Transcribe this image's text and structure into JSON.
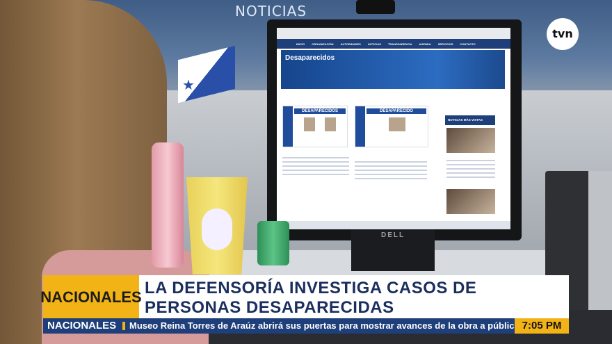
{
  "scene": {
    "wall_sign": "NOTICIAS",
    "monitor_brand": "DELL",
    "channel_logo": "tvn"
  },
  "screen": {
    "banner_title": "Desaparecidos",
    "nav": [
      "INICIO",
      "ORGANIZACIÓN",
      "AUTORIDADES",
      "NOTICIAS",
      "TRANSPARENCIA",
      "AGENDA",
      "SERVICIOS",
      "CONTACTO"
    ],
    "card1_title": "DESAPARECIDOS",
    "card2_title": "DESAPARECIDO",
    "sidebar_title": "NOTICIAS MÁS VISTAS"
  },
  "lower_third": {
    "tag": "NACIONALES",
    "headline": "LA DEFENSORÍA INVESTIGA CASOS DE PERSONAS DESAPARECIDAS"
  },
  "ticker": {
    "tag": "NACIONALES",
    "text": "Museo Reina Torres de Araúz abrirá sus puertas para mostrar avances de la obra a público con reservas",
    "time": "7:05 PM"
  }
}
